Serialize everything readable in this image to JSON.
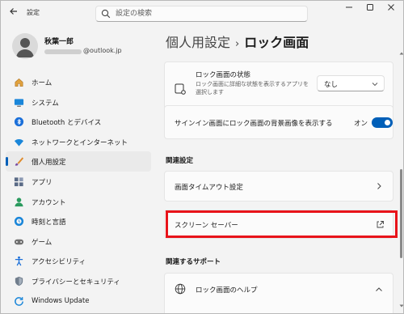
{
  "titlebar": {
    "app_title": "設定",
    "search_placeholder": "設定の検索"
  },
  "profile": {
    "name": "秋葉一郎",
    "email_visible": "@outlook.jp"
  },
  "sidebar": {
    "items": [
      {
        "label": "ホーム",
        "icon": "home-icon",
        "active": false
      },
      {
        "label": "システム",
        "icon": "system-icon",
        "active": false
      },
      {
        "label": "Bluetooth とデバイス",
        "icon": "bluetooth-icon",
        "active": false
      },
      {
        "label": "ネットワークとインターネット",
        "icon": "network-icon",
        "active": false
      },
      {
        "label": "個人用設定",
        "icon": "personalization-icon",
        "active": true
      },
      {
        "label": "アプリ",
        "icon": "apps-icon",
        "active": false
      },
      {
        "label": "アカウント",
        "icon": "account-icon",
        "active": false
      },
      {
        "label": "時刻と言語",
        "icon": "time-language-icon",
        "active": false
      },
      {
        "label": "ゲーム",
        "icon": "gaming-icon",
        "active": false
      },
      {
        "label": "アクセシビリティ",
        "icon": "accessibility-icon",
        "active": false
      },
      {
        "label": "プライバシーとセキュリティ",
        "icon": "privacy-icon",
        "active": false
      },
      {
        "label": "Windows Update",
        "icon": "windows-update-icon",
        "active": false
      }
    ]
  },
  "breadcrumb": {
    "parent": "個人用設定",
    "separator": "›",
    "current": "ロック画面"
  },
  "lock_status": {
    "title": "ロック画面の状態",
    "description": "ロック画面に詳細な状態を表示するアプリを選択します",
    "value": "なし"
  },
  "signin_bg": {
    "title": "サインイン画面にロック画面の背景画像を表示する",
    "toggle_label": "オン"
  },
  "related_settings": {
    "title": "関連設定",
    "items": [
      {
        "label": "画面タイムアウト設定"
      },
      {
        "label": "スクリーン セーバー"
      }
    ]
  },
  "related_support": {
    "title": "関連するサポート",
    "help_label": "ロック画面のヘルプ"
  },
  "colors": {
    "accent": "#005fb8",
    "highlight": "#e8131a"
  }
}
